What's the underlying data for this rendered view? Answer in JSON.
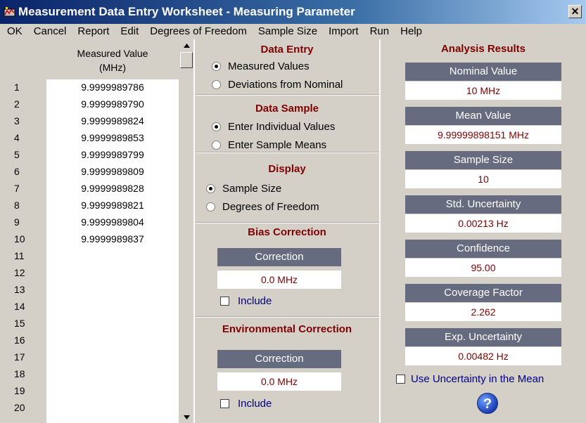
{
  "window": {
    "title": "Measurement Data Entry Worksheet - Measuring Parameter",
    "close_label": "✕"
  },
  "menu": [
    "OK",
    "Cancel",
    "Report",
    "Edit",
    "Degrees of Freedom",
    "Sample Size",
    "Import",
    "Run",
    "Help"
  ],
  "table": {
    "header_line1": "Measured Value",
    "header_line2": "(MHz)",
    "rows": [
      {
        "n": "1",
        "v": "9.9999989786"
      },
      {
        "n": "2",
        "v": "9.9999989790"
      },
      {
        "n": "3",
        "v": "9.9999989824"
      },
      {
        "n": "4",
        "v": "9.9999989853"
      },
      {
        "n": "5",
        "v": "9.9999989799"
      },
      {
        "n": "6",
        "v": "9.9999989809"
      },
      {
        "n": "7",
        "v": "9.9999989828"
      },
      {
        "n": "8",
        "v": "9.9999989821"
      },
      {
        "n": "9",
        "v": "9.9999989804"
      },
      {
        "n": "10",
        "v": "9.9999989837"
      },
      {
        "n": "11",
        "v": ""
      },
      {
        "n": "12",
        "v": ""
      },
      {
        "n": "13",
        "v": ""
      },
      {
        "n": "14",
        "v": ""
      },
      {
        "n": "15",
        "v": ""
      },
      {
        "n": "16",
        "v": ""
      },
      {
        "n": "17",
        "v": ""
      },
      {
        "n": "18",
        "v": ""
      },
      {
        "n": "19",
        "v": ""
      },
      {
        "n": "20",
        "v": ""
      }
    ]
  },
  "data_entry": {
    "title": "Data Entry",
    "opt1": "Measured Values",
    "opt2": "Deviations from Nominal",
    "selected": "opt1"
  },
  "data_sample": {
    "title": "Data Sample",
    "opt1": "Enter Individual Values",
    "opt2": "Enter Sample Means",
    "selected": "opt1"
  },
  "display": {
    "title": "Display",
    "opt1": "Sample Size",
    "opt2": "Degrees of Freedom",
    "selected": "opt1"
  },
  "bias_correction": {
    "title": "Bias Correction",
    "head": "Correction",
    "value": "0.0 MHz",
    "include_label": "Include",
    "include_checked": false
  },
  "environmental_correction": {
    "title": "Environmental Correction",
    "head": "Correction",
    "value": "0.0 MHz",
    "include_label": "Include",
    "include_checked": false
  },
  "analysis": {
    "title": "Analysis Results",
    "items": [
      {
        "label": "Nominal Value",
        "value": "10 MHz"
      },
      {
        "label": "Mean Value",
        "value": "9.99999898151 MHz"
      },
      {
        "label": "Sample Size",
        "value": "10"
      },
      {
        "label": "Std. Uncertainty",
        "value": "0.00213 Hz"
      },
      {
        "label": "Confidence",
        "value": "95.00"
      },
      {
        "label": "Coverage Factor",
        "value": "2.262"
      },
      {
        "label": "Exp. Uncertainty",
        "value": "0.00482 Hz"
      }
    ],
    "use_uncertainty_label": "Use Uncertainty in the Mean",
    "use_uncertainty_checked": false,
    "help_glyph": "?"
  },
  "colors": {
    "title_gradient_start": "#0a246a",
    "title_gradient_end": "#a6caf0",
    "panel_bg": "#d4d0c8",
    "section_title": "#800000",
    "box_header_bg": "#666b7f",
    "value_text": "#800000",
    "checkbox_label": "#000080"
  },
  "icons": {
    "app_icon": "app-icon",
    "close": "close-icon",
    "scroll_up": "arrow-up-icon",
    "scroll_down": "arrow-down-icon",
    "help": "help-icon"
  }
}
